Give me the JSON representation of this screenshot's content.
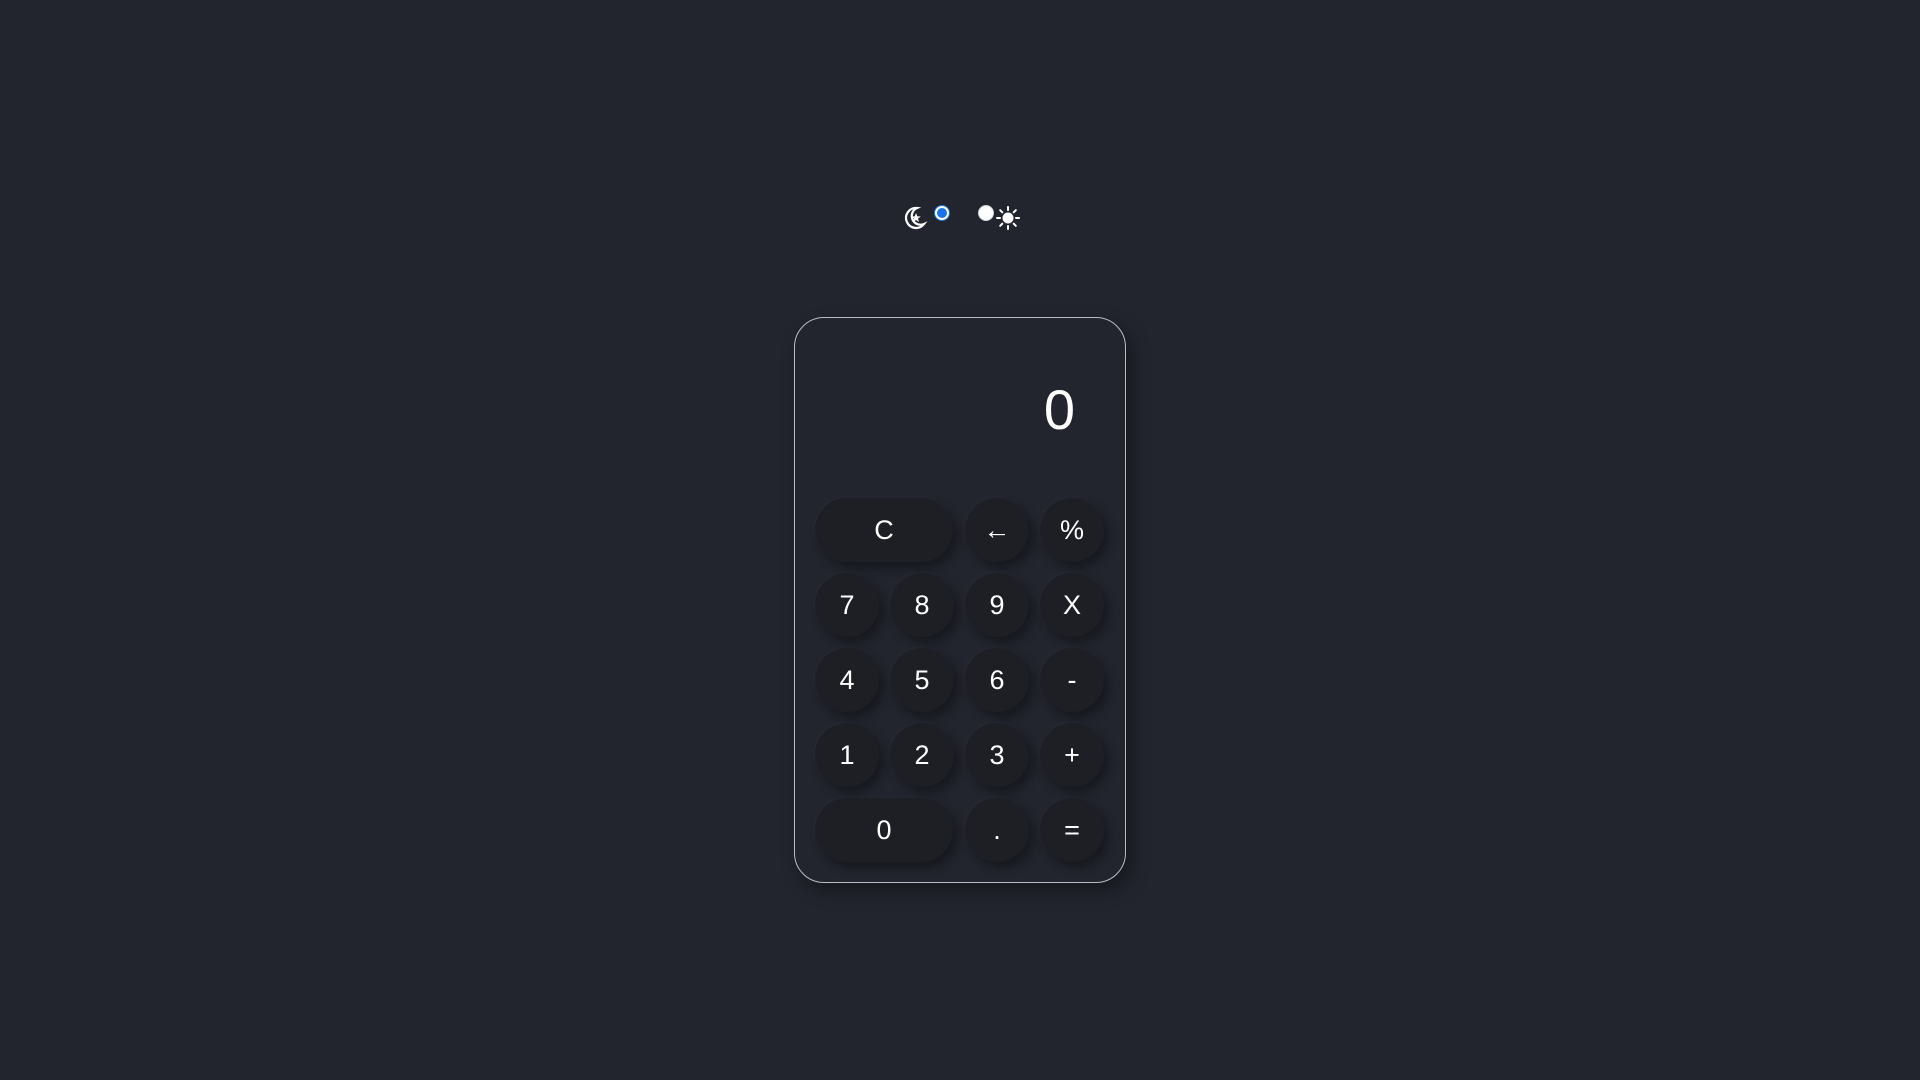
{
  "theme_toggle": {
    "dark_icon": "moon-star-icon",
    "light_icon": "sun-icon",
    "selected": "dark"
  },
  "calculator": {
    "display_value": "0",
    "buttons": {
      "clear": "C",
      "backspace": "←",
      "percent": "%",
      "seven": "7",
      "eight": "8",
      "nine": "9",
      "multiply": "X",
      "four": "4",
      "five": "5",
      "six": "6",
      "minus": "-",
      "one": "1",
      "two": "2",
      "three": "3",
      "plus": "+",
      "zero": "0",
      "decimal": ".",
      "equals": "="
    }
  },
  "colors": {
    "background": "#22252e",
    "button": "#1d1f24",
    "text": "#ffffff",
    "radio_accent": "#1a73e8",
    "border": "#b9bcc4"
  }
}
